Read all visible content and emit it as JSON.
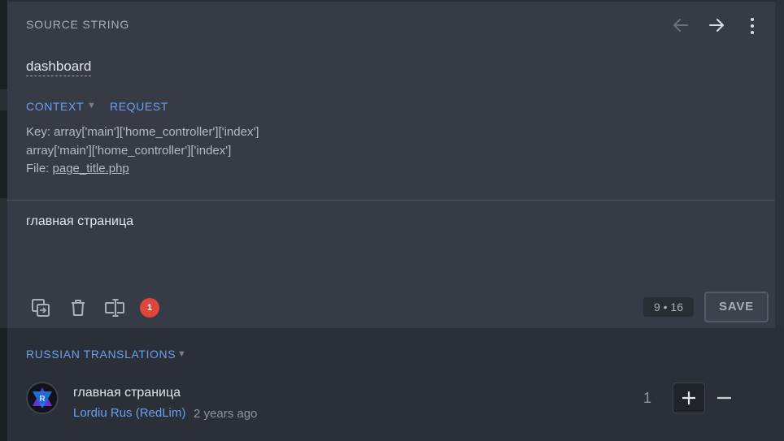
{
  "editor": {
    "section_label": "SOURCE STRING",
    "source_text": "dashboard",
    "tabs": {
      "context": "CONTEXT",
      "request": "REQUEST"
    },
    "context": {
      "key_line": "Key: array['main']['home_controller']['index']",
      "key_line2": "array['main']['home_controller']['index']",
      "file_prefix": "File: ",
      "file_name": "page_title.php"
    },
    "translation": "главная страница",
    "toolbar": {
      "icons": [
        "copy-source-icon",
        "delete-icon",
        "machine-translate-icon"
      ],
      "badge_count": "1"
    },
    "counter": "9 • 16",
    "save_label": "SAVE"
  },
  "translations_section": {
    "label": "RUSSIAN TRANSLATIONS",
    "items": [
      {
        "text": "главная страница",
        "author": "Lordiu Rus (RedLim)",
        "time": "2 years ago",
        "votes": "1"
      }
    ]
  },
  "colors": {
    "accent": "#6aa0f0",
    "badge": "#e0473a",
    "editor_bg": "#363b45",
    "lower_bg": "#2b2f37"
  }
}
